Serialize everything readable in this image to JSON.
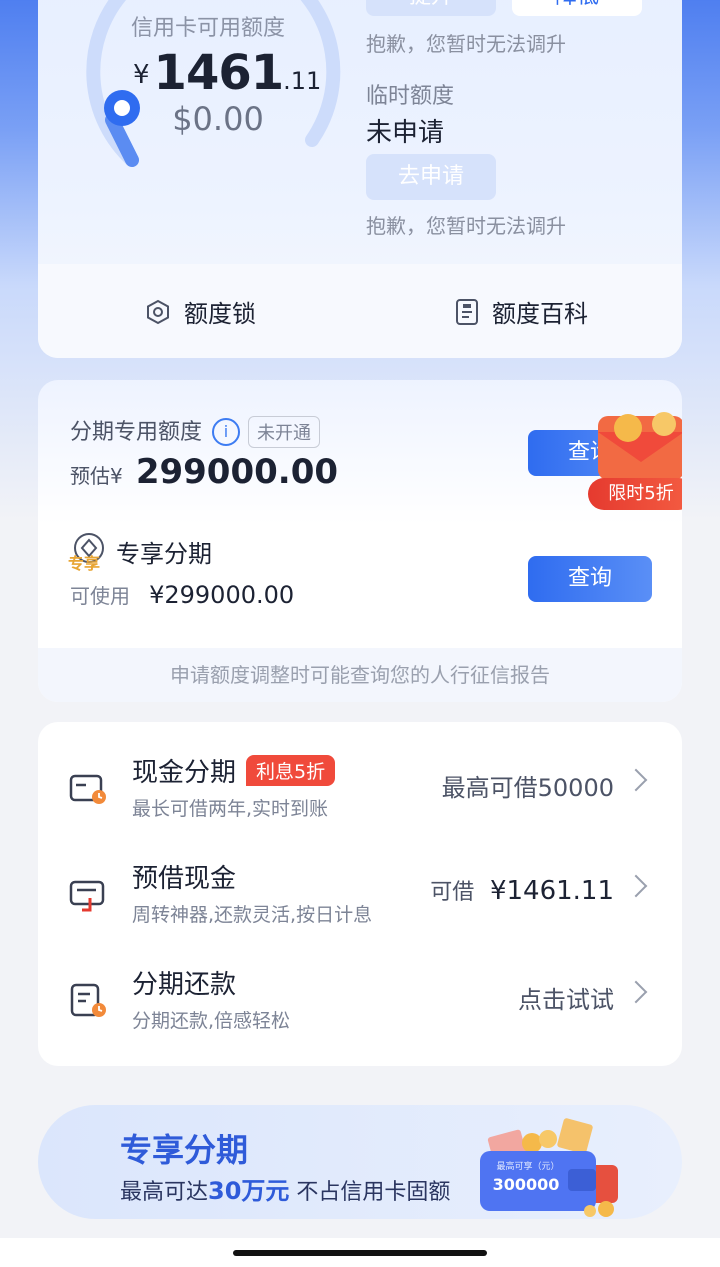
{
  "credit": {
    "available_label": "信用卡可用额度",
    "currency": "¥",
    "amount_int": "1461",
    "amount_dec": ".11",
    "sub_amount": "$0.00",
    "btn_raise": "提升",
    "btn_lower": "降低",
    "note1": "抱歉，您暂时无法调升",
    "temp_label": "临时额度",
    "temp_status": "未申请",
    "btn_apply": "去申请",
    "note2": "抱歉，您暂时无法调升",
    "lock_label": "额度锁",
    "wiki_label": "额度百科"
  },
  "installment": {
    "title": "分期专用额度",
    "status_tag": "未开通",
    "estimate_label": "预估¥",
    "estimate_value": "299000.00",
    "query_btn_1": "查询",
    "promo_tag": "限时5折",
    "exclusive_badge": "专享",
    "exclusive_title": "专享分期",
    "usable_label": "可使用",
    "usable_value": "¥299000.00",
    "query_btn_2": "查询",
    "footer": "申请额度调整时可能查询您的人行征信报告"
  },
  "list": [
    {
      "title": "现金分期",
      "tag": "利息5折",
      "sub": "最长可借两年,实时到账",
      "right": "最高可借50000"
    },
    {
      "title": "预借现金",
      "sub": "周转神器,还款灵活,按日计息",
      "right_label": "可借",
      "right_value": "¥1461.11"
    },
    {
      "title": "分期还款",
      "sub": "分期还款,倍感轻松",
      "right": "点击试试"
    }
  ],
  "banner": {
    "title": "专享分期",
    "sub_prefix": "最高可达",
    "sub_highlight": "30万元",
    "sub_suffix": " 不占信用卡固额",
    "wallet_caption": "最高可享（元）",
    "wallet_amount": "300000"
  },
  "colors": {
    "accent": "#2f6cf0",
    "promo_red": "#f04a3b",
    "text_dark": "#1c2233"
  }
}
